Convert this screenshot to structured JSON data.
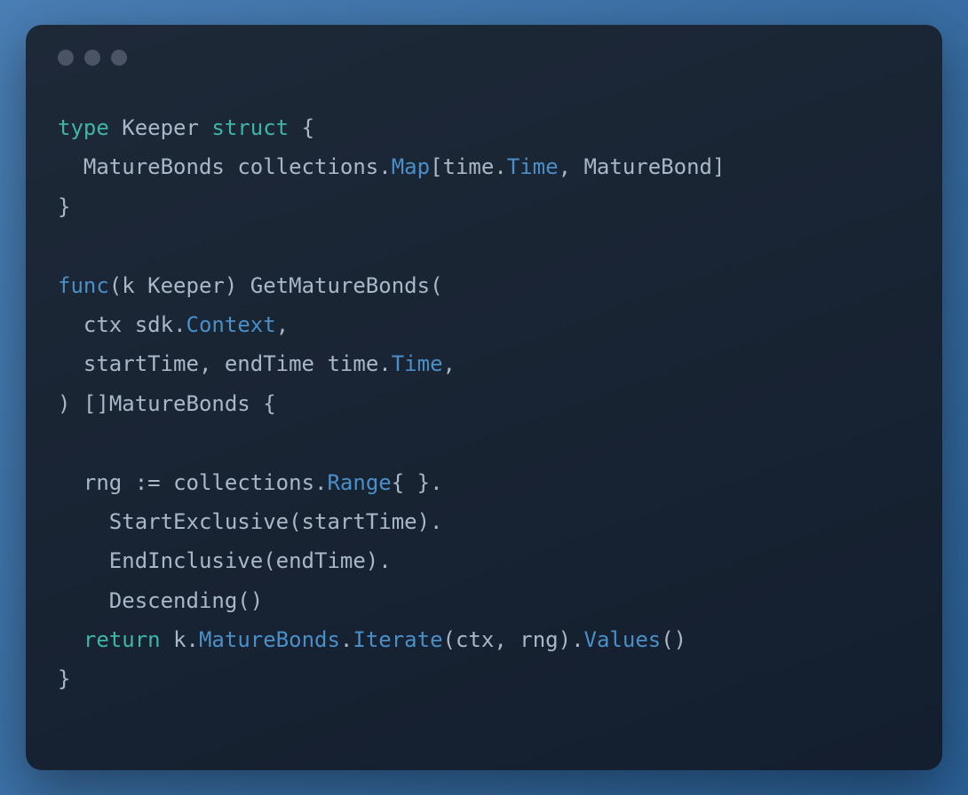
{
  "code": {
    "line1": {
      "type": "type",
      "name": "Keeper",
      "struct": "struct",
      "brace": "{"
    },
    "line2": {
      "field": "MatureBonds",
      "pkg": "collections",
      "map": "Map",
      "time_pkg": "time",
      "time_type": "Time",
      "value_type": "MatureBond"
    },
    "line3": {
      "brace": "}"
    },
    "line5": {
      "func": "func",
      "receiver_var": "k",
      "receiver_type": "Keeper",
      "method_name": "GetMatureBonds"
    },
    "line6": {
      "param": "ctx",
      "pkg": "sdk",
      "type": "Context"
    },
    "line7": {
      "param1": "startTime",
      "param2": "endTime",
      "pkg": "time",
      "type": "Time"
    },
    "line8": {
      "return_type": "MatureBonds",
      "brace": "{"
    },
    "line10": {
      "var": "rng",
      "walrus": ":=",
      "pkg": "collections",
      "type": "Range",
      "braces": "{ }"
    },
    "line11": {
      "method": "StartExclusive",
      "arg": "startTime"
    },
    "line12": {
      "method": "EndInclusive",
      "arg": "endTime"
    },
    "line13": {
      "method": "Descending"
    },
    "line14": {
      "return": "return",
      "var": "k",
      "field": "MatureBonds",
      "method1": "Iterate",
      "arg1": "ctx",
      "arg2": "rng",
      "method2": "Values"
    },
    "line15": {
      "brace": "}"
    }
  }
}
